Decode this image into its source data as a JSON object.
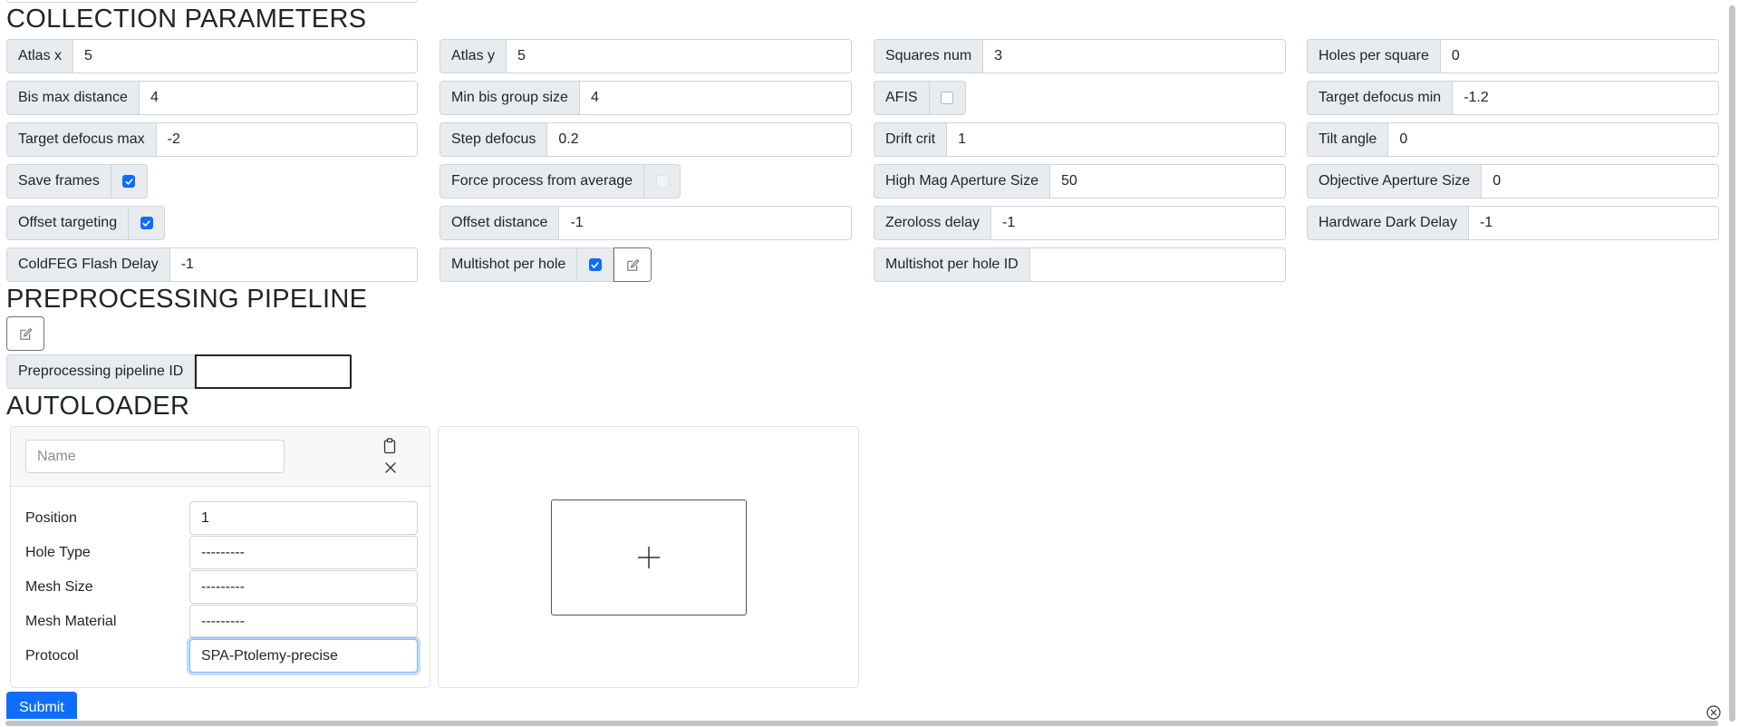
{
  "headings": {
    "collection": "COLLECTION PARAMETERS",
    "preprocessing": "PREPROCESSING PIPELINE",
    "autoloader": "AUTOLOADER"
  },
  "params": {
    "atlas_x": {
      "label": "Atlas x",
      "value": "5"
    },
    "atlas_y": {
      "label": "Atlas y",
      "value": "5"
    },
    "squares_num": {
      "label": "Squares num",
      "value": "3"
    },
    "holes_per_square": {
      "label": "Holes per square",
      "value": "0"
    },
    "bis_max_distance": {
      "label": "Bis max distance",
      "value": "4"
    },
    "min_bis_group_size": {
      "label": "Min bis group size",
      "value": "4"
    },
    "afis": {
      "label": "AFIS",
      "checked": false
    },
    "target_defocus_min": {
      "label": "Target defocus min",
      "value": "-1.2"
    },
    "target_defocus_max": {
      "label": "Target defocus max",
      "value": "-2"
    },
    "step_defocus": {
      "label": "Step defocus",
      "value": "0.2"
    },
    "drift_crit": {
      "label": "Drift crit",
      "value": "1"
    },
    "tilt_angle": {
      "label": "Tilt angle",
      "value": "0"
    },
    "save_frames": {
      "label": "Save frames",
      "checked": true
    },
    "force_process": {
      "label": "Force process from average",
      "checked": false,
      "disabled": true
    },
    "high_mag_aperture": {
      "label": "High Mag Aperture Size",
      "value": "50"
    },
    "objective_aperture": {
      "label": "Objective Aperture Size",
      "value": "0"
    },
    "offset_targeting": {
      "label": "Offset targeting",
      "checked": true
    },
    "offset_distance": {
      "label": "Offset distance",
      "value": "-1"
    },
    "zeroloss_delay": {
      "label": "Zeroloss delay",
      "value": "-1"
    },
    "hardware_dark_delay": {
      "label": "Hardware Dark Delay",
      "value": "-1"
    },
    "coldfeg_flash_delay": {
      "label": "ColdFEG Flash Delay",
      "value": "-1"
    },
    "multishot_per_hole": {
      "label": "Multishot per hole",
      "checked": true
    },
    "multishot_per_hole_id": {
      "label": "Multishot per hole ID",
      "value": ""
    }
  },
  "preprocessing": {
    "pipeline_id_label": "Preprocessing pipeline ID",
    "pipeline_id_value": ""
  },
  "autoloader": {
    "name_placeholder": "Name",
    "fields": {
      "position": {
        "label": "Position",
        "value": "1"
      },
      "hole_type": {
        "label": "Hole Type",
        "value": "---------"
      },
      "mesh_size": {
        "label": "Mesh Size",
        "value": "---------"
      },
      "mesh_material": {
        "label": "Mesh Material",
        "value": "---------"
      },
      "protocol": {
        "label": "Protocol",
        "value": "SPA-Ptolemy-precise"
      }
    }
  },
  "submit_label": "Submit",
  "colors": {
    "primary": "#0d6efd",
    "label_bg": "#e9ecef",
    "border": "#ced4da"
  }
}
